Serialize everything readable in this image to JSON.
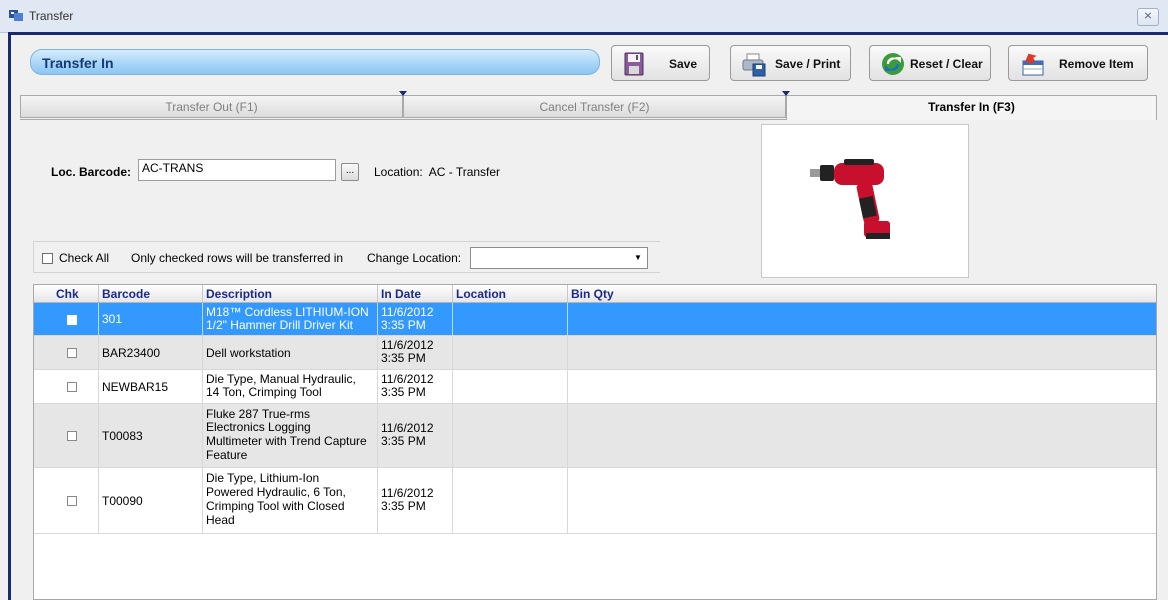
{
  "window": {
    "title": "Transfer",
    "close_glyph": "⨯"
  },
  "form": {
    "title": "Transfer In"
  },
  "toolbar": {
    "save_label": "Save",
    "save_print_label": "Save / Print",
    "reset_label": "Reset / Clear",
    "remove_label": "Remove Item"
  },
  "tabs": [
    {
      "label": "Transfer Out (F1)",
      "active": false
    },
    {
      "label": "Cancel Transfer (F2)",
      "active": false
    },
    {
      "label": "Transfer In (F3)",
      "active": true
    }
  ],
  "location": {
    "barcode_label": "Loc. Barcode:",
    "barcode_value": "AC-TRANS",
    "browse_label": "...",
    "location_label": "Location:",
    "location_value": "AC - Transfer"
  },
  "filters": {
    "check_all_label": "Check All",
    "hint": "Only checked rows will be transferred in",
    "change_location_label": "Change Location:",
    "change_location_value": ""
  },
  "grid": {
    "columns": [
      "Chk",
      "Barcode",
      "Description",
      "In Date",
      "Location",
      "Bin Qty"
    ],
    "rows": [
      {
        "checked": false,
        "selected": true,
        "barcode": "301",
        "description": [
          "M18™ Cordless LITHIUM-ION",
          "1/2\" Hammer Drill Driver Kit"
        ],
        "in_date": [
          "11/6/2012",
          "3:35 PM"
        ],
        "location": "",
        "bin_qty": ""
      },
      {
        "checked": false,
        "selected": false,
        "barcode": "BAR23400",
        "description": [
          "Dell workstation"
        ],
        "in_date": [
          "11/6/2012",
          "3:35 PM"
        ],
        "location": "",
        "bin_qty": ""
      },
      {
        "checked": false,
        "selected": false,
        "barcode": "NEWBAR15",
        "description": [
          "Die Type, Manual Hydraulic,",
          "14 Ton, Crimping Tool"
        ],
        "in_date": [
          "11/6/2012",
          "3:35 PM"
        ],
        "location": "",
        "bin_qty": ""
      },
      {
        "checked": false,
        "selected": false,
        "barcode": "T00083",
        "description": [
          "Fluke 287 True-rms",
          "Electronics Logging",
          "Multimeter with Trend Capture",
          "Feature"
        ],
        "in_date": [
          "11/6/2012",
          "3:35 PM"
        ],
        "location": "",
        "bin_qty": ""
      },
      {
        "checked": false,
        "selected": false,
        "barcode": "T00090",
        "description": [
          "Die Type, Lithium-Ion",
          "Powered Hydraulic, 6 Ton,",
          "Crimping Tool with Closed",
          "Head"
        ],
        "in_date": [
          "11/6/2012",
          "3:35 PM"
        ],
        "location": "",
        "bin_qty": ""
      }
    ]
  },
  "colors": {
    "selected_row": "#3399ff",
    "alt_row": "#e6e6e6",
    "header_text": "#1a2a8c",
    "title_bar": "#a9d6f7",
    "frame_accent": "#1a2a6c"
  },
  "icons": {
    "app": "app-icon",
    "save": "floppy-disk-icon",
    "save_print": "printer-icon",
    "reset": "refresh-arrows-icon",
    "remove": "remove-item-icon",
    "product": "power-drill-image"
  }
}
